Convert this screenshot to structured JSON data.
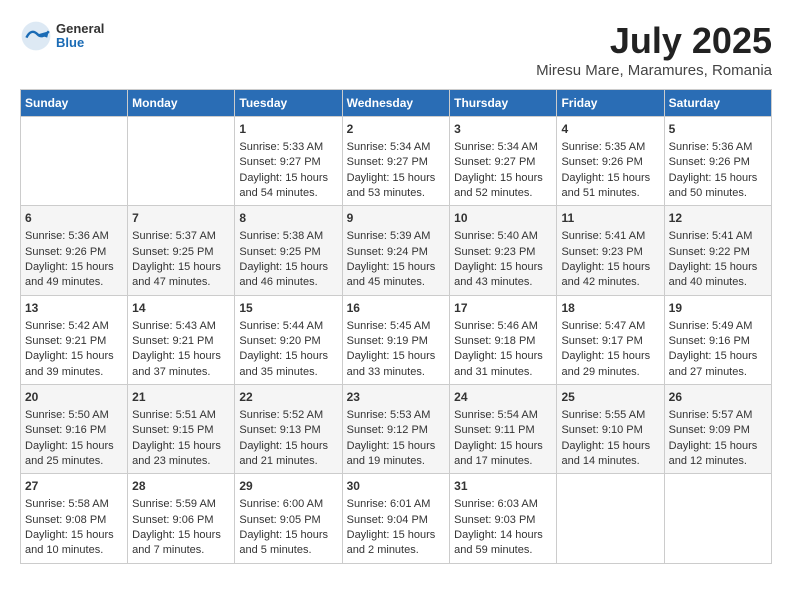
{
  "header": {
    "logo_general": "General",
    "logo_blue": "Blue",
    "title": "July 2025",
    "subtitle": "Miresu Mare, Maramures, Romania"
  },
  "weekdays": [
    "Sunday",
    "Monday",
    "Tuesday",
    "Wednesday",
    "Thursday",
    "Friday",
    "Saturday"
  ],
  "weeks": [
    [
      {
        "day": "",
        "info": ""
      },
      {
        "day": "",
        "info": ""
      },
      {
        "day": "1",
        "info": "Sunrise: 5:33 AM\nSunset: 9:27 PM\nDaylight: 15 hours\nand 54 minutes."
      },
      {
        "day": "2",
        "info": "Sunrise: 5:34 AM\nSunset: 9:27 PM\nDaylight: 15 hours\nand 53 minutes."
      },
      {
        "day": "3",
        "info": "Sunrise: 5:34 AM\nSunset: 9:27 PM\nDaylight: 15 hours\nand 52 minutes."
      },
      {
        "day": "4",
        "info": "Sunrise: 5:35 AM\nSunset: 9:26 PM\nDaylight: 15 hours\nand 51 minutes."
      },
      {
        "day": "5",
        "info": "Sunrise: 5:36 AM\nSunset: 9:26 PM\nDaylight: 15 hours\nand 50 minutes."
      }
    ],
    [
      {
        "day": "6",
        "info": "Sunrise: 5:36 AM\nSunset: 9:26 PM\nDaylight: 15 hours\nand 49 minutes."
      },
      {
        "day": "7",
        "info": "Sunrise: 5:37 AM\nSunset: 9:25 PM\nDaylight: 15 hours\nand 47 minutes."
      },
      {
        "day": "8",
        "info": "Sunrise: 5:38 AM\nSunset: 9:25 PM\nDaylight: 15 hours\nand 46 minutes."
      },
      {
        "day": "9",
        "info": "Sunrise: 5:39 AM\nSunset: 9:24 PM\nDaylight: 15 hours\nand 45 minutes."
      },
      {
        "day": "10",
        "info": "Sunrise: 5:40 AM\nSunset: 9:23 PM\nDaylight: 15 hours\nand 43 minutes."
      },
      {
        "day": "11",
        "info": "Sunrise: 5:41 AM\nSunset: 9:23 PM\nDaylight: 15 hours\nand 42 minutes."
      },
      {
        "day": "12",
        "info": "Sunrise: 5:41 AM\nSunset: 9:22 PM\nDaylight: 15 hours\nand 40 minutes."
      }
    ],
    [
      {
        "day": "13",
        "info": "Sunrise: 5:42 AM\nSunset: 9:21 PM\nDaylight: 15 hours\nand 39 minutes."
      },
      {
        "day": "14",
        "info": "Sunrise: 5:43 AM\nSunset: 9:21 PM\nDaylight: 15 hours\nand 37 minutes."
      },
      {
        "day": "15",
        "info": "Sunrise: 5:44 AM\nSunset: 9:20 PM\nDaylight: 15 hours\nand 35 minutes."
      },
      {
        "day": "16",
        "info": "Sunrise: 5:45 AM\nSunset: 9:19 PM\nDaylight: 15 hours\nand 33 minutes."
      },
      {
        "day": "17",
        "info": "Sunrise: 5:46 AM\nSunset: 9:18 PM\nDaylight: 15 hours\nand 31 minutes."
      },
      {
        "day": "18",
        "info": "Sunrise: 5:47 AM\nSunset: 9:17 PM\nDaylight: 15 hours\nand 29 minutes."
      },
      {
        "day": "19",
        "info": "Sunrise: 5:49 AM\nSunset: 9:16 PM\nDaylight: 15 hours\nand 27 minutes."
      }
    ],
    [
      {
        "day": "20",
        "info": "Sunrise: 5:50 AM\nSunset: 9:16 PM\nDaylight: 15 hours\nand 25 minutes."
      },
      {
        "day": "21",
        "info": "Sunrise: 5:51 AM\nSunset: 9:15 PM\nDaylight: 15 hours\nand 23 minutes."
      },
      {
        "day": "22",
        "info": "Sunrise: 5:52 AM\nSunset: 9:13 PM\nDaylight: 15 hours\nand 21 minutes."
      },
      {
        "day": "23",
        "info": "Sunrise: 5:53 AM\nSunset: 9:12 PM\nDaylight: 15 hours\nand 19 minutes."
      },
      {
        "day": "24",
        "info": "Sunrise: 5:54 AM\nSunset: 9:11 PM\nDaylight: 15 hours\nand 17 minutes."
      },
      {
        "day": "25",
        "info": "Sunrise: 5:55 AM\nSunset: 9:10 PM\nDaylight: 15 hours\nand 14 minutes."
      },
      {
        "day": "26",
        "info": "Sunrise: 5:57 AM\nSunset: 9:09 PM\nDaylight: 15 hours\nand 12 minutes."
      }
    ],
    [
      {
        "day": "27",
        "info": "Sunrise: 5:58 AM\nSunset: 9:08 PM\nDaylight: 15 hours\nand 10 minutes."
      },
      {
        "day": "28",
        "info": "Sunrise: 5:59 AM\nSunset: 9:06 PM\nDaylight: 15 hours\nand 7 minutes."
      },
      {
        "day": "29",
        "info": "Sunrise: 6:00 AM\nSunset: 9:05 PM\nDaylight: 15 hours\nand 5 minutes."
      },
      {
        "day": "30",
        "info": "Sunrise: 6:01 AM\nSunset: 9:04 PM\nDaylight: 15 hours\nand 2 minutes."
      },
      {
        "day": "31",
        "info": "Sunrise: 6:03 AM\nSunset: 9:03 PM\nDaylight: 14 hours\nand 59 minutes."
      },
      {
        "day": "",
        "info": ""
      },
      {
        "day": "",
        "info": ""
      }
    ]
  ]
}
